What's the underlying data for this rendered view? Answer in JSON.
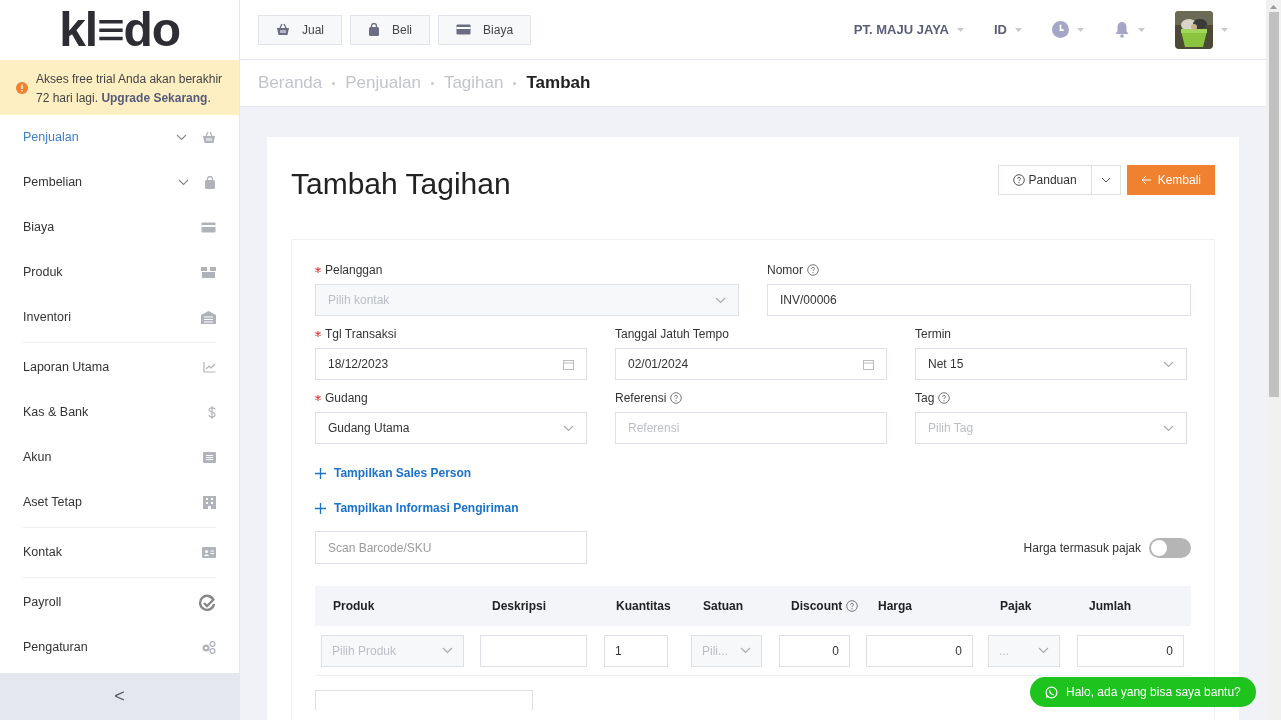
{
  "logo": "kl≡do",
  "trial_banner": "Akses free trial Anda akan berakhir 72 hari lagi. **Upgrade Sekarang**.",
  "sidebar": {
    "items": [
      {
        "label": "Penjualan",
        "selected": true,
        "expandable": true,
        "divider_after": false
      },
      {
        "label": "Pembelian",
        "selected": false,
        "expandable": true,
        "divider_after": false
      },
      {
        "label": "Biaya",
        "selected": false,
        "expandable": false,
        "divider_after": false
      },
      {
        "label": "Produk",
        "selected": false,
        "expandable": false,
        "divider_after": false
      },
      {
        "label": "Inventori",
        "selected": false,
        "expandable": false,
        "divider_after": true
      },
      {
        "label": "Laporan Utama",
        "selected": false,
        "expandable": false,
        "divider_after": false
      },
      {
        "label": "Kas & Bank",
        "selected": false,
        "expandable": false,
        "divider_after": false
      },
      {
        "label": "Akun",
        "selected": false,
        "expandable": false,
        "divider_after": false
      },
      {
        "label": "Aset Tetap",
        "selected": false,
        "expandable": false,
        "divider_after": true
      },
      {
        "label": "Kontak",
        "selected": false,
        "expandable": false,
        "divider_after": true
      },
      {
        "label": "Payroll",
        "selected": false,
        "expandable": false,
        "divider_after": false
      },
      {
        "label": "Pengaturan",
        "selected": false,
        "expandable": false,
        "divider_after": false
      }
    ],
    "collapse": "<"
  },
  "topbar": {
    "quick_buttons": [
      "Jual",
      "Beli",
      "Biaya"
    ],
    "company": "PT. MAJU JAYA",
    "language": "ID"
  },
  "breadcrumb": [
    {
      "label": "Beranda",
      "current": false
    },
    {
      "label": "Penjualan",
      "current": false
    },
    {
      "label": "Tagihan",
      "current": false
    },
    {
      "label": "Tambah",
      "current": true
    }
  ],
  "page_title": "Tambah Tagihan",
  "guide_button": "Panduan",
  "back_button": "Kembali",
  "field_rows": [
    [
      {
        "label": "Pelanggan",
        "required": true,
        "help": false,
        "kind": "select",
        "placeholder": "Pilih kontak"
      },
      {
        "label": "Nomor",
        "required": false,
        "help": true,
        "kind": "input",
        "value": "INV/00006"
      }
    ],
    [
      {
        "label": "Tgl Transaksi",
        "required": true,
        "help": false,
        "kind": "date",
        "value": "18/12/2023"
      },
      {
        "label": "Tanggal Jatuh Tempo",
        "required": false,
        "help": false,
        "kind": "date",
        "value": "02/01/2024"
      },
      {
        "label": "Termin",
        "required": false,
        "help": false,
        "kind": "select",
        "value": "Net 15"
      }
    ],
    [
      {
        "label": "Gudang",
        "required": true,
        "help": false,
        "kind": "select",
        "value": "Gudang Utama"
      },
      {
        "label": "Referensi",
        "required": false,
        "help": true,
        "kind": "input",
        "placeholder": "Referensi"
      },
      {
        "label": "Tag",
        "required": false,
        "help": true,
        "kind": "select",
        "placeholder": "Pilih Tag"
      }
    ]
  ],
  "links": [
    "Tampilkan Sales Person",
    "Tampilkan Informasi Pengiriman"
  ],
  "barcode_placeholder": "Scan Barcode/SKU",
  "tax_inclusive": {
    "label": "Harga termasuk pajak",
    "on": false
  },
  "table": {
    "columns": [
      {
        "header": "Produk",
        "help": false,
        "cell": {
          "kind": "select",
          "placeholder": "Pilih Produk"
        }
      },
      {
        "header": "Deskripsi",
        "help": false,
        "cell": {
          "kind": "input"
        }
      },
      {
        "header": "Kuantitas",
        "help": false,
        "cell": {
          "kind": "input",
          "value": "1"
        }
      },
      {
        "header": "Satuan",
        "help": false,
        "cell": {
          "kind": "select",
          "placeholder": "Pili..."
        }
      },
      {
        "header": "Discount",
        "help": true,
        "cell": {
          "kind": "number",
          "value": "0"
        }
      },
      {
        "header": "Harga",
        "help": false,
        "cell": {
          "kind": "number",
          "value": "0"
        }
      },
      {
        "header": "Pajak",
        "help": false,
        "cell": {
          "kind": "select",
          "placeholder": "..."
        }
      },
      {
        "header": "Jumlah",
        "help": false,
        "cell": {
          "kind": "number",
          "value": "0"
        }
      }
    ]
  },
  "chat_button": "Halo, ada yang bisa saya bantu?"
}
